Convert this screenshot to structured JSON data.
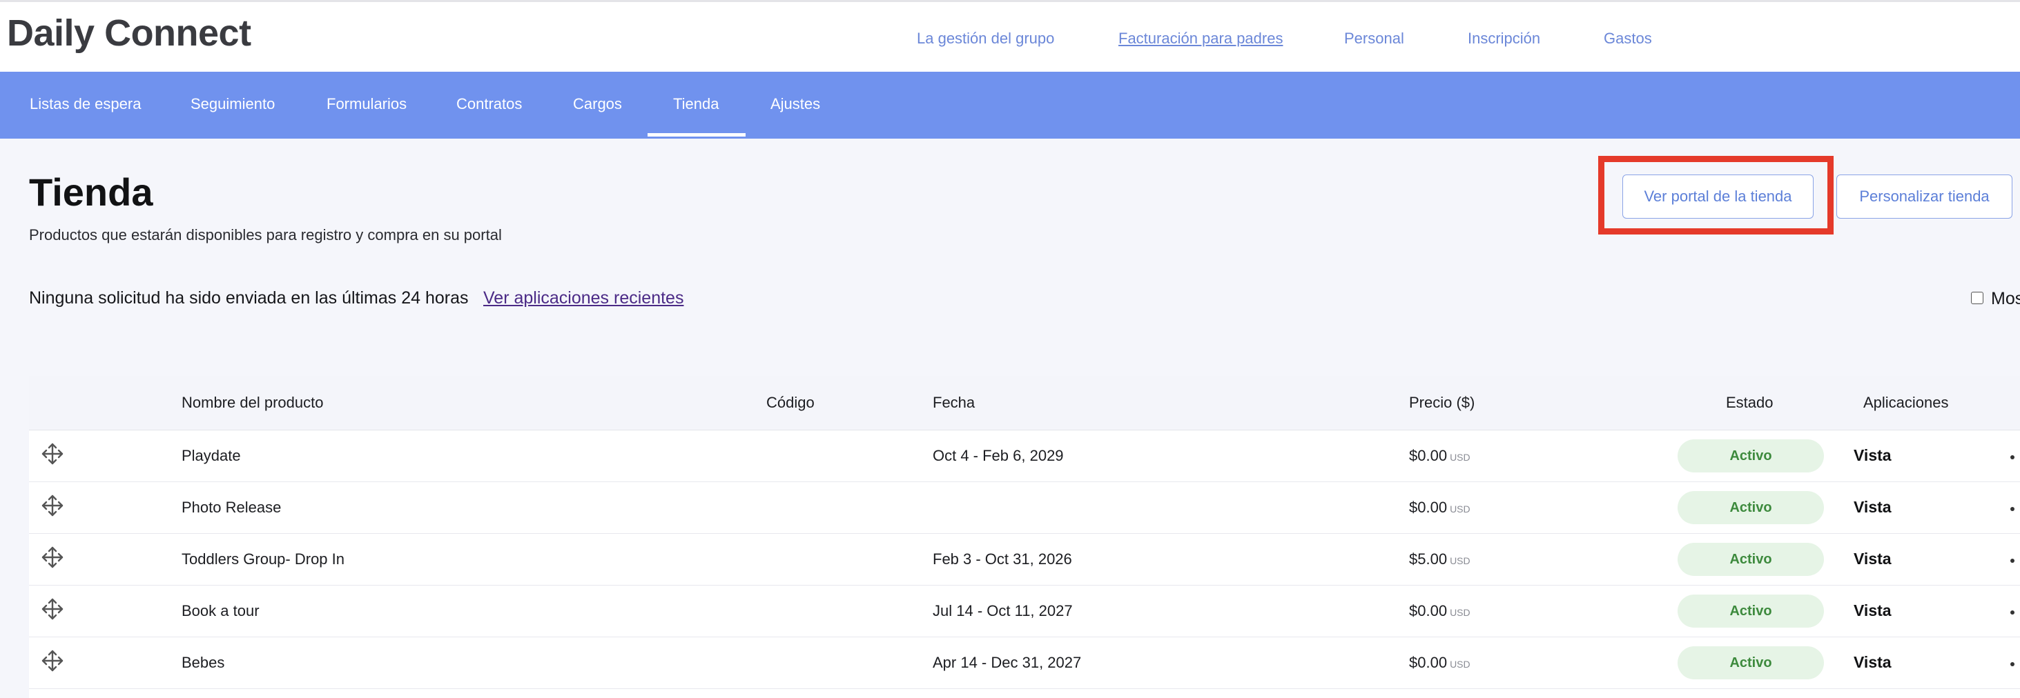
{
  "app": {
    "title": "Daily Connect"
  },
  "top_nav": [
    {
      "label": "La gestión del grupo"
    },
    {
      "label": "Facturación para padres"
    },
    {
      "label": "Personal"
    },
    {
      "label": "Inscripción"
    },
    {
      "label": "Gastos"
    }
  ],
  "sub_nav": [
    {
      "label": "Listas de espera"
    },
    {
      "label": "Seguimiento"
    },
    {
      "label": "Formularios"
    },
    {
      "label": "Contratos"
    },
    {
      "label": "Cargos"
    },
    {
      "label": "Tienda",
      "active": true
    },
    {
      "label": "Ajustes"
    }
  ],
  "page": {
    "title": "Tienda",
    "subtitle": "Productos que estarán disponibles para registro y compra en su portal",
    "view_portal_button": "Ver portal de la tienda",
    "customize_button": "Personalizar tienda",
    "notice": "Ninguna solicitud ha sido enviada en las últimas 24 horas",
    "recent_link": "Ver aplicaciones recientes",
    "show_checkbox_label": "Mos"
  },
  "table": {
    "headers": {
      "name": "Nombre del producto",
      "code": "Código",
      "date": "Fecha",
      "price": "Precio ($)",
      "status": "Estado",
      "apps": "Aplicaciones"
    },
    "rows": [
      {
        "name": "Playdate",
        "code": "",
        "date": "Oct 4 - Feb 6, 2029",
        "price": "$0.00",
        "currency": "USD",
        "status": "Activo",
        "apps": "Vista"
      },
      {
        "name": "Photo Release",
        "code": "",
        "date": "",
        "price": "$0.00",
        "currency": "USD",
        "status": "Activo",
        "apps": "Vista"
      },
      {
        "name": "Toddlers Group- Drop In",
        "code": "",
        "date": "Feb 3 - Oct 31, 2026",
        "price": "$5.00",
        "currency": "USD",
        "status": "Activo",
        "apps": "Vista"
      },
      {
        "name": "Book a tour",
        "code": "",
        "date": "Jul 14 - Oct 11, 2027",
        "price": "$0.00",
        "currency": "USD",
        "status": "Activo",
        "apps": "Vista"
      },
      {
        "name": "Bebes",
        "code": "",
        "date": "Apr 14 - Dec 31, 2027",
        "price": "$0.00",
        "currency": "USD",
        "status": "Activo",
        "apps": "Vista"
      }
    ]
  },
  "colors": {
    "accent": "#7092ee",
    "link": "#6b87d8",
    "highlight": "#e53a2a",
    "status_bg": "#e6f4e6",
    "status_text": "#3d8a3d"
  },
  "icons": {
    "drag_handle": "move-arrows-icon",
    "checkbox": "checkbox-icon"
  }
}
